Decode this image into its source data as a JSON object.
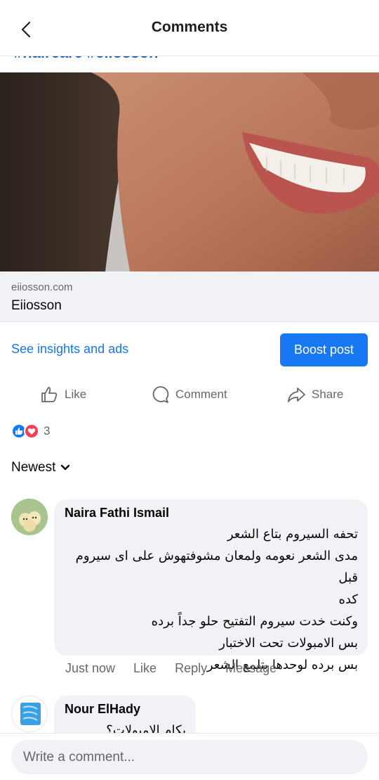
{
  "header": {
    "title": "Comments"
  },
  "post": {
    "hashtags": "#haircare #eiiosson",
    "link_domain": "eiiosson.com",
    "link_title": "Eiiosson"
  },
  "insights": {
    "link_label": "See insights and ads",
    "boost_label": "Boost post"
  },
  "actions": {
    "like": "Like",
    "comment": "Comment",
    "share": "Share"
  },
  "reactions": {
    "count": "3",
    "types": [
      "like-icon",
      "love-icon"
    ]
  },
  "sort": {
    "label": "Newest"
  },
  "comments": [
    {
      "name": "Naira Fathi Ismail",
      "lines": [
        "تحفه السيروم بتاع الشعر",
        "مدى الشعر نعومه ولمعان مشوفتهوش على اى سيروم قبل",
        "كده",
        "وكنت خدت سيروم التفتيح حلو جداً برده",
        "بس الامبولات تحت الاختبار",
        "بس برده لوحدها بتلمع الشعر"
      ],
      "time": "Just now",
      "like": "Like",
      "reply": "Reply",
      "message": "Message"
    },
    {
      "name": "Nour ElHady",
      "lines": [
        "بكام الامبولات؟"
      ]
    }
  ],
  "composer": {
    "placeholder": "Write a comment..."
  },
  "colors": {
    "accent": "#1877f2",
    "bubble": "#f0f2f5",
    "secondary_text": "#65676b"
  }
}
